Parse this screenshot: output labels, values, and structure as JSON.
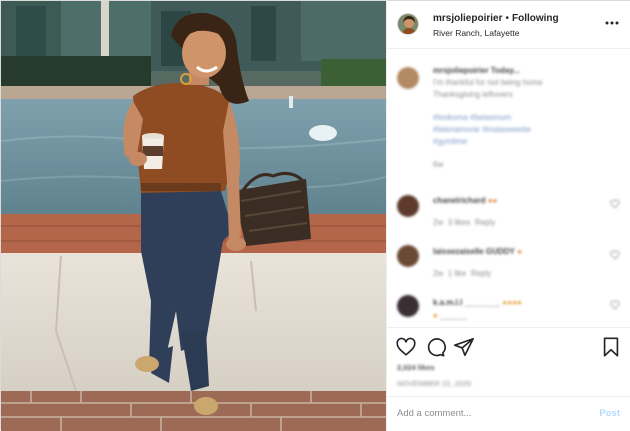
{
  "header": {
    "username": "mrsjoliepoirier",
    "separator": "•",
    "follow_status": "Following",
    "location": "River Ranch, Lafayette",
    "more_icon": "more-horizontal-icon"
  },
  "caption": {
    "line1": "mrsjoliepoirier Today...",
    "line2": "I'm thankful for not being home",
    "line3": "Thanksgiving leftovers",
    "tags1": "#lookoma #belasmum",
    "tags2": "#latenamorar #instasweetie",
    "tags3": "#gymlime",
    "time": "6w"
  },
  "comments": [
    {
      "user": "chanelrichard",
      "time": "2w",
      "likes": "3 likes",
      "reply": "Reply"
    },
    {
      "user": "laissezaiselle GUDDY",
      "time": "2w",
      "likes": "1 like",
      "reply": "Reply"
    },
    {
      "user": "k.a.m.l.l",
      "time": "2w",
      "likes": "",
      "reply": "Reply"
    }
  ],
  "actions": {
    "like_icon": "heart-icon",
    "comment_icon": "comment-icon",
    "share_icon": "share-icon",
    "save_icon": "bookmark-icon",
    "likes_count": "2,024 likes",
    "date": "NOVEMBER 22, 2020"
  },
  "add_comment": {
    "placeholder": "Add a comment...",
    "post_label": "Post"
  }
}
